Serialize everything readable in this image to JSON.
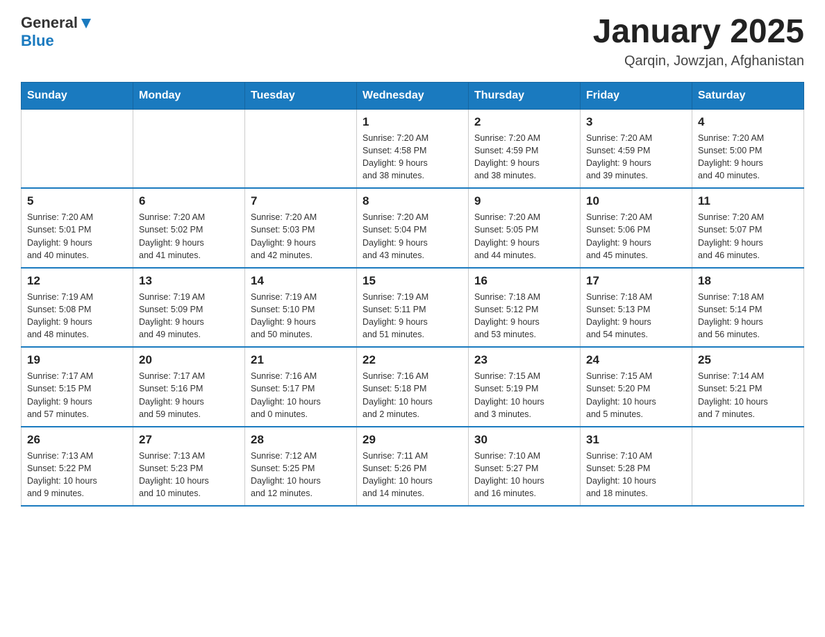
{
  "header": {
    "logo": {
      "general": "General",
      "blue": "Blue"
    },
    "title": "January 2025",
    "subtitle": "Qarqin, Jowzjan, Afghanistan"
  },
  "calendar": {
    "days_of_week": [
      "Sunday",
      "Monday",
      "Tuesday",
      "Wednesday",
      "Thursday",
      "Friday",
      "Saturday"
    ],
    "weeks": [
      [
        {
          "day": "",
          "info": ""
        },
        {
          "day": "",
          "info": ""
        },
        {
          "day": "",
          "info": ""
        },
        {
          "day": "1",
          "info": "Sunrise: 7:20 AM\nSunset: 4:58 PM\nDaylight: 9 hours\nand 38 minutes."
        },
        {
          "day": "2",
          "info": "Sunrise: 7:20 AM\nSunset: 4:59 PM\nDaylight: 9 hours\nand 38 minutes."
        },
        {
          "day": "3",
          "info": "Sunrise: 7:20 AM\nSunset: 4:59 PM\nDaylight: 9 hours\nand 39 minutes."
        },
        {
          "day": "4",
          "info": "Sunrise: 7:20 AM\nSunset: 5:00 PM\nDaylight: 9 hours\nand 40 minutes."
        }
      ],
      [
        {
          "day": "5",
          "info": "Sunrise: 7:20 AM\nSunset: 5:01 PM\nDaylight: 9 hours\nand 40 minutes."
        },
        {
          "day": "6",
          "info": "Sunrise: 7:20 AM\nSunset: 5:02 PM\nDaylight: 9 hours\nand 41 minutes."
        },
        {
          "day": "7",
          "info": "Sunrise: 7:20 AM\nSunset: 5:03 PM\nDaylight: 9 hours\nand 42 minutes."
        },
        {
          "day": "8",
          "info": "Sunrise: 7:20 AM\nSunset: 5:04 PM\nDaylight: 9 hours\nand 43 minutes."
        },
        {
          "day": "9",
          "info": "Sunrise: 7:20 AM\nSunset: 5:05 PM\nDaylight: 9 hours\nand 44 minutes."
        },
        {
          "day": "10",
          "info": "Sunrise: 7:20 AM\nSunset: 5:06 PM\nDaylight: 9 hours\nand 45 minutes."
        },
        {
          "day": "11",
          "info": "Sunrise: 7:20 AM\nSunset: 5:07 PM\nDaylight: 9 hours\nand 46 minutes."
        }
      ],
      [
        {
          "day": "12",
          "info": "Sunrise: 7:19 AM\nSunset: 5:08 PM\nDaylight: 9 hours\nand 48 minutes."
        },
        {
          "day": "13",
          "info": "Sunrise: 7:19 AM\nSunset: 5:09 PM\nDaylight: 9 hours\nand 49 minutes."
        },
        {
          "day": "14",
          "info": "Sunrise: 7:19 AM\nSunset: 5:10 PM\nDaylight: 9 hours\nand 50 minutes."
        },
        {
          "day": "15",
          "info": "Sunrise: 7:19 AM\nSunset: 5:11 PM\nDaylight: 9 hours\nand 51 minutes."
        },
        {
          "day": "16",
          "info": "Sunrise: 7:18 AM\nSunset: 5:12 PM\nDaylight: 9 hours\nand 53 minutes."
        },
        {
          "day": "17",
          "info": "Sunrise: 7:18 AM\nSunset: 5:13 PM\nDaylight: 9 hours\nand 54 minutes."
        },
        {
          "day": "18",
          "info": "Sunrise: 7:18 AM\nSunset: 5:14 PM\nDaylight: 9 hours\nand 56 minutes."
        }
      ],
      [
        {
          "day": "19",
          "info": "Sunrise: 7:17 AM\nSunset: 5:15 PM\nDaylight: 9 hours\nand 57 minutes."
        },
        {
          "day": "20",
          "info": "Sunrise: 7:17 AM\nSunset: 5:16 PM\nDaylight: 9 hours\nand 59 minutes."
        },
        {
          "day": "21",
          "info": "Sunrise: 7:16 AM\nSunset: 5:17 PM\nDaylight: 10 hours\nand 0 minutes."
        },
        {
          "day": "22",
          "info": "Sunrise: 7:16 AM\nSunset: 5:18 PM\nDaylight: 10 hours\nand 2 minutes."
        },
        {
          "day": "23",
          "info": "Sunrise: 7:15 AM\nSunset: 5:19 PM\nDaylight: 10 hours\nand 3 minutes."
        },
        {
          "day": "24",
          "info": "Sunrise: 7:15 AM\nSunset: 5:20 PM\nDaylight: 10 hours\nand 5 minutes."
        },
        {
          "day": "25",
          "info": "Sunrise: 7:14 AM\nSunset: 5:21 PM\nDaylight: 10 hours\nand 7 minutes."
        }
      ],
      [
        {
          "day": "26",
          "info": "Sunrise: 7:13 AM\nSunset: 5:22 PM\nDaylight: 10 hours\nand 9 minutes."
        },
        {
          "day": "27",
          "info": "Sunrise: 7:13 AM\nSunset: 5:23 PM\nDaylight: 10 hours\nand 10 minutes."
        },
        {
          "day": "28",
          "info": "Sunrise: 7:12 AM\nSunset: 5:25 PM\nDaylight: 10 hours\nand 12 minutes."
        },
        {
          "day": "29",
          "info": "Sunrise: 7:11 AM\nSunset: 5:26 PM\nDaylight: 10 hours\nand 14 minutes."
        },
        {
          "day": "30",
          "info": "Sunrise: 7:10 AM\nSunset: 5:27 PM\nDaylight: 10 hours\nand 16 minutes."
        },
        {
          "day": "31",
          "info": "Sunrise: 7:10 AM\nSunset: 5:28 PM\nDaylight: 10 hours\nand 18 minutes."
        },
        {
          "day": "",
          "info": ""
        }
      ]
    ]
  }
}
